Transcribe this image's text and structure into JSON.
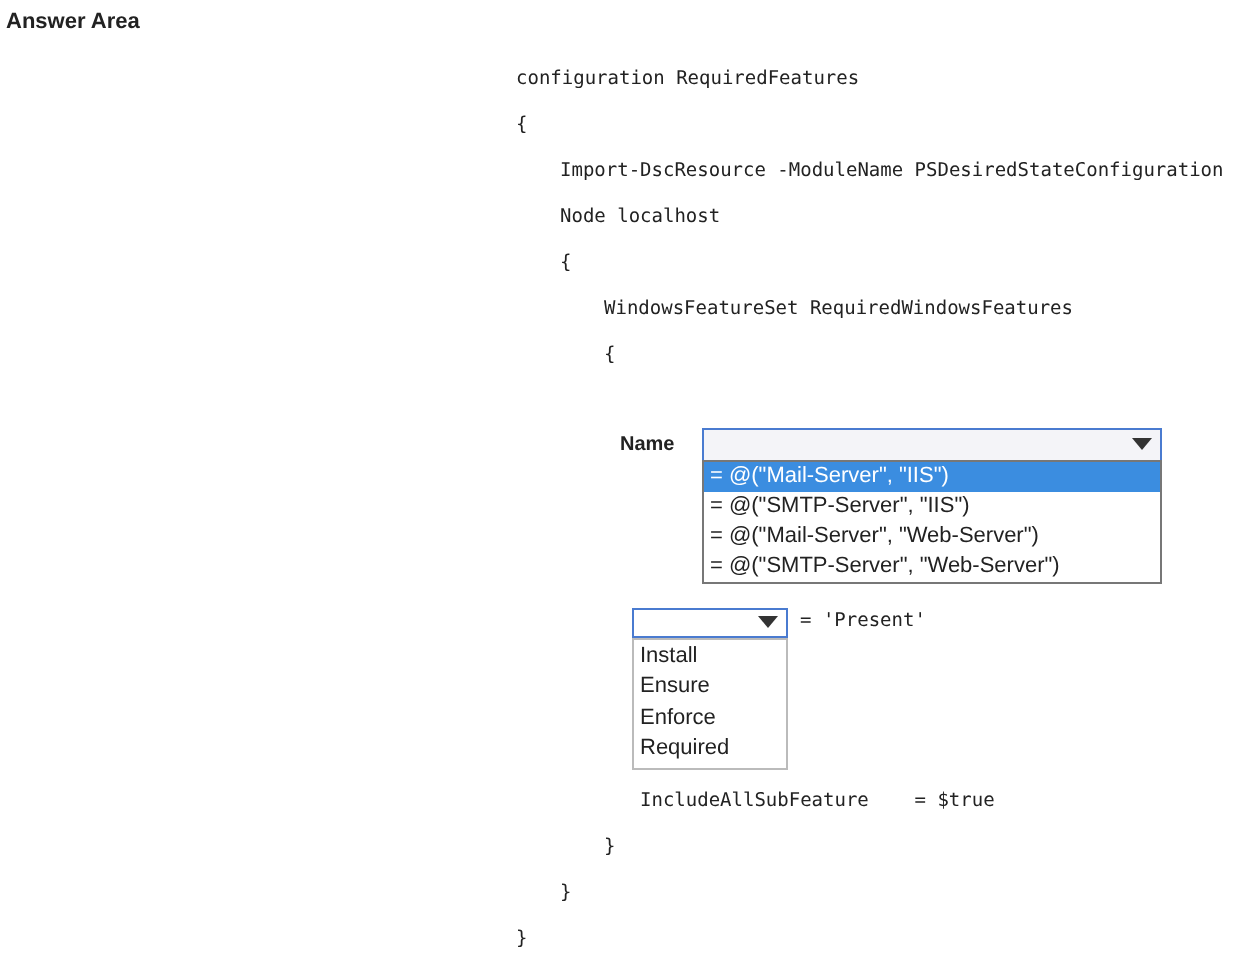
{
  "heading": "Answer Area",
  "code_top": [
    {
      "text": "configuration RequiredFeatures",
      "kind": "config"
    },
    {
      "text": "{",
      "kind": "config"
    },
    {
      "text": "Import-DscResource -ModuleName PSDesiredStateConfiguration",
      "kind": "node"
    },
    {
      "text": "Node localhost",
      "kind": "node"
    },
    {
      "text": "{",
      "kind": "node"
    },
    {
      "text": "WindowsFeatureSet RequiredWindowsFeatures",
      "kind": "resource"
    },
    {
      "text": "{",
      "kind": "resource"
    }
  ],
  "name_row": {
    "label": "Name",
    "dropdown": {
      "expanded": true,
      "options": [
        {
          "text": "= @(\"Mail-Server\", \"IIS\")",
          "selected": true
        },
        {
          "text": "= @(\"SMTP-Server\", \"IIS\")",
          "selected": false
        },
        {
          "text": "= @(\"Mail-Server\", \"Web-Server\")",
          "selected": false
        },
        {
          "text": "= @(\"SMTP-Server\", \"Web-Server\")",
          "selected": false
        }
      ]
    }
  },
  "ensure_row": {
    "dropdown": {
      "expanded": true,
      "options": [
        {
          "text": "Install",
          "selected": false
        },
        {
          "text": "Ensure",
          "selected": false
        },
        {
          "text": "Enforce",
          "selected": false
        },
        {
          "text": "Required",
          "selected": false
        }
      ]
    },
    "value": "= 'Present'"
  },
  "code_bottom": [
    {
      "text": "IncludeAllSubFeature    = $true",
      "kind": "property"
    },
    {
      "text": "}",
      "kind": "resource"
    },
    {
      "text": "}",
      "kind": "node"
    },
    {
      "text": "}",
      "kind": "config"
    }
  ]
}
